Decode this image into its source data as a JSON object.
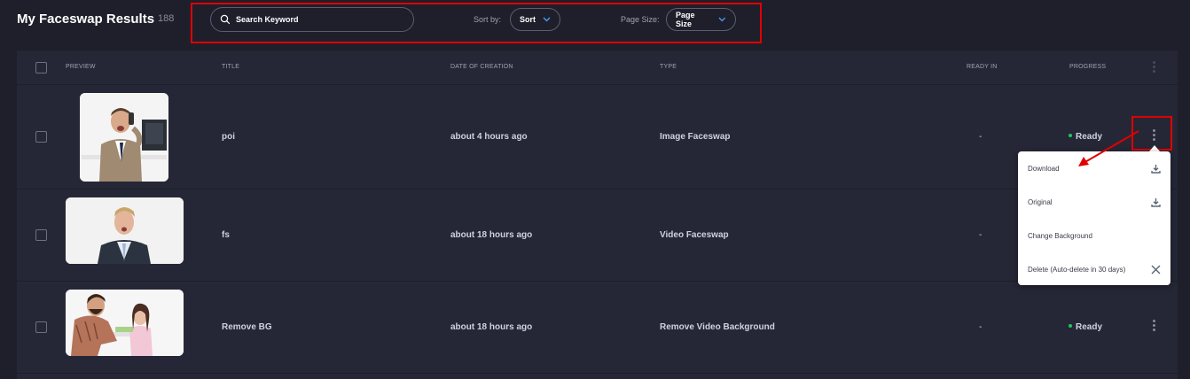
{
  "header": {
    "title": "My Faceswap Results",
    "count": "188",
    "search": {
      "placeholder": "Search Keyword",
      "value": ""
    },
    "sort_label": "Sort by:",
    "sort_value": "Sort",
    "page_size_label": "Page Size:",
    "page_size_value": "Page Size"
  },
  "table": {
    "columns": [
      "PREVIEW",
      "TITLE",
      "DATE OF CREATION",
      "TYPE",
      "READY IN",
      "PROGRESS"
    ],
    "rows": [
      {
        "title": "poi",
        "date": "about 4 hours ago",
        "type": "Image Faceswap",
        "ready_in": "-",
        "progress": "Ready",
        "thumb": "man-on-phone-at-desk"
      },
      {
        "title": "fs",
        "date": "about 18 hours ago",
        "type": "Video Faceswap",
        "ready_in": "-",
        "progress": "",
        "thumb": "man-in-suit-portrait"
      },
      {
        "title": "Remove BG",
        "date": "about 18 hours ago",
        "type": "Remove Video Background",
        "ready_in": "-",
        "progress": "Ready",
        "thumb": "man-and-girl-at-table"
      }
    ]
  },
  "context_menu": {
    "items": [
      {
        "label": "Download",
        "icon": "download-icon"
      },
      {
        "label": "Original",
        "icon": "download-icon"
      },
      {
        "label": "Change Background",
        "icon": ""
      },
      {
        "label": "Delete (Auto-delete in 30 days)",
        "icon": "close-icon"
      }
    ]
  },
  "colors": {
    "background": "#1e1f2b",
    "table": "#262736",
    "annotation": "#e00000",
    "ready_dot": "#22c55e",
    "accent_chevron": "#4aa3ff"
  }
}
